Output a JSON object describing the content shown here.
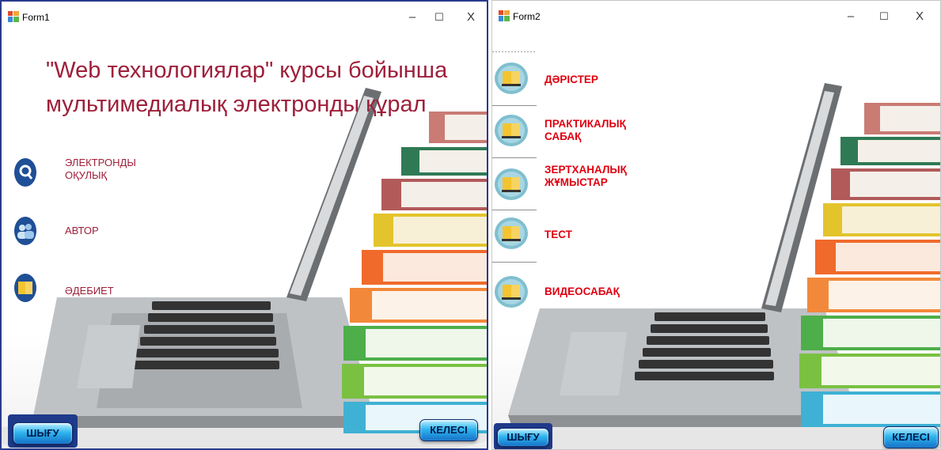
{
  "form1": {
    "title": "Form1",
    "controls": {
      "minimize": "–",
      "maximize": "☐",
      "close": "X"
    },
    "headline_line1": "\"Web технологиялар\" курсы бойынша",
    "headline_line2": "мультимедиалық электронды құрал",
    "menu": [
      {
        "label": "ЭЛЕКТРОНДЫ\nОҚУЛЫҚ",
        "icon": "search-icon"
      },
      {
        "label": "АВТОР",
        "icon": "users-icon"
      },
      {
        "label": "ӘДЕБИЕТ",
        "icon": "book-icon"
      }
    ],
    "exit_button": "ШЫҒУ",
    "next_button": "КЕЛЕСІ"
  },
  "form2": {
    "title": "Form2",
    "controls": {
      "minimize": "–",
      "maximize": "☐",
      "close": "X"
    },
    "menu": [
      {
        "label": "ДӘРІСТЕР",
        "icon": "book-icon"
      },
      {
        "label": "ПРАКТИКАЛЫҚ\nСАБАҚ",
        "icon": "book-icon"
      },
      {
        "label": "ЗЕРТХАНАЛЫҚ\nЖҰМЫСТАР",
        "icon": "book-icon"
      },
      {
        "label": "ТЕСТ",
        "icon": "book-icon"
      },
      {
        "label": "ВИДЕОСАБАҚ",
        "icon": "book-icon"
      }
    ],
    "exit_button": "ШЫҒУ",
    "next_button": "КЕЛЕСІ"
  },
  "colors": {
    "accent_dark_red": "#9e1f3a",
    "accent_red": "#e00010",
    "button_blue": "#2fb6ef",
    "window_border": "#2b3a8e"
  }
}
